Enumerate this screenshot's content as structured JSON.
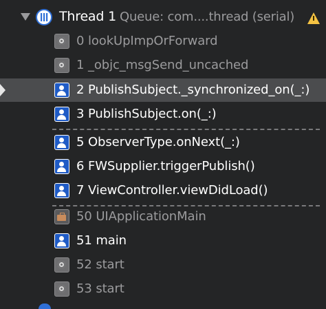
{
  "thread": {
    "title": "Thread 1",
    "queue": "Queue: com....thread (serial)",
    "expanded": true
  },
  "frames": [
    {
      "label": "0 lookUpImpOrForward",
      "icon": "gear-icon",
      "style": "dim"
    },
    {
      "label": "1 _objc_msgSend_uncached",
      "icon": "gear-icon",
      "style": "dim"
    },
    {
      "label": "2 PublishSubject._synchronized_on(_:)",
      "icon": "user-icon",
      "style": "bright",
      "selected": true
    },
    {
      "label": "3 PublishSubject.on(_:)",
      "icon": "user-icon",
      "style": "bright"
    },
    {
      "label": "5 ObserverType.onNext(_:)",
      "icon": "user-icon",
      "style": "bright"
    },
    {
      "label": "6 FWSupplier.triggerPublish()",
      "icon": "user-icon",
      "style": "bright"
    },
    {
      "label": "7 ViewController.viewDidLoad()",
      "icon": "user-icon",
      "style": "bright"
    },
    {
      "label": "50 UIApplicationMain",
      "icon": "briefcase-icon",
      "style": "dim"
    },
    {
      "label": "51 main",
      "icon": "user-icon",
      "style": "bright"
    },
    {
      "label": "52 start",
      "icon": "gear-icon",
      "style": "dim"
    },
    {
      "label": "53 start",
      "icon": "gear-icon",
      "style": "dim"
    }
  ],
  "colors": {
    "background": "#242526",
    "selected_row": "#4b4c4e",
    "user_frame_icon": "#1f5bc6",
    "warning": "#f5c343"
  }
}
